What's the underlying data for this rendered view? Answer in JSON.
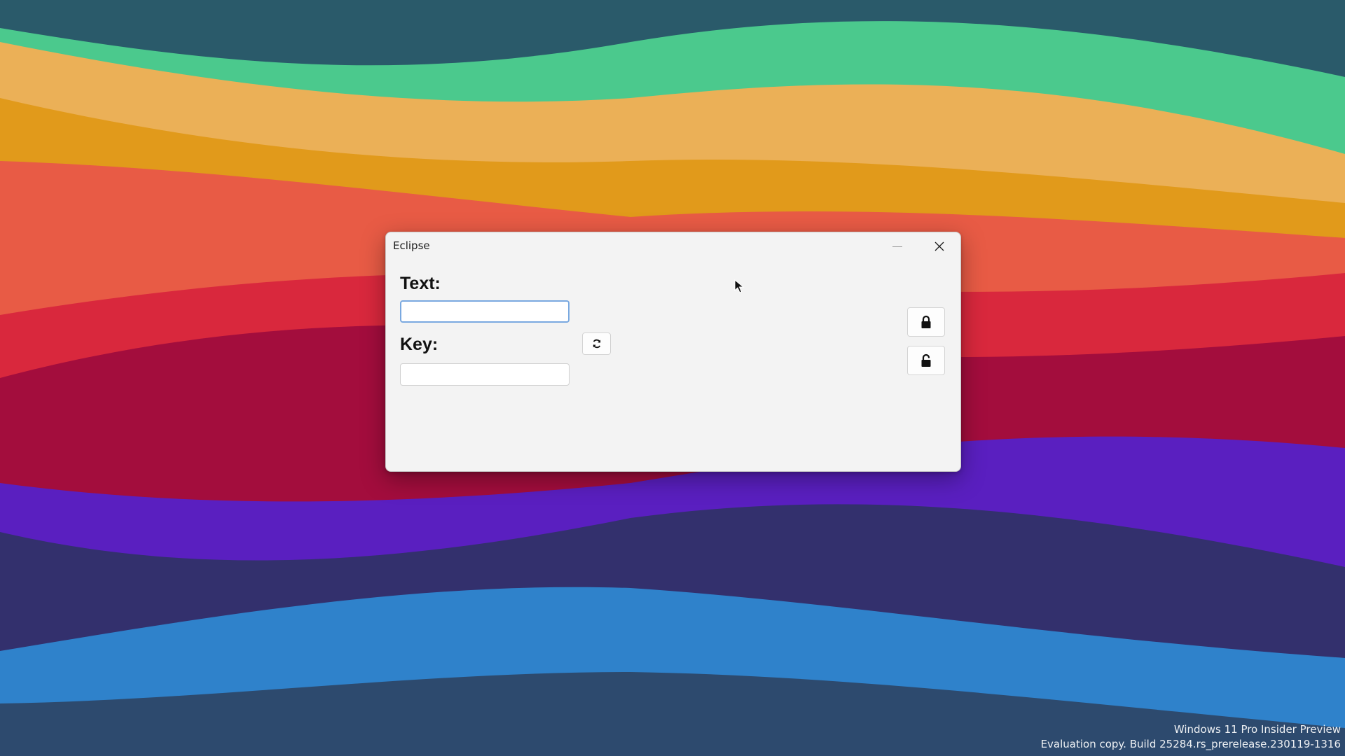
{
  "window": {
    "title": "Eclipse"
  },
  "form": {
    "text_label": "Text:",
    "text_value": "",
    "key_label": "Key:",
    "key_value": ""
  },
  "icons": {
    "refresh": "refresh-icon",
    "encrypt": "lock-closed-icon",
    "decrypt": "lock-open-icon",
    "minimize": "minimize-icon",
    "close": "close-icon"
  },
  "watermark": {
    "line1": "Windows 11 Pro Insider Preview",
    "line2": "Evaluation copy. Build 25284.rs_prerelease.230119-1316"
  },
  "colors": {
    "window_bg": "#f3f3f3",
    "focus_border": "#7aa9e0",
    "wallpaper_bands": [
      "#2a5a6a",
      "#4bc98d",
      "#ebb057",
      "#e19a1b",
      "#e85b45",
      "#d9283d",
      "#a30d3d",
      "#5a1fc0",
      "#33306d",
      "#2f82cb",
      "#2d4a6e"
    ]
  }
}
